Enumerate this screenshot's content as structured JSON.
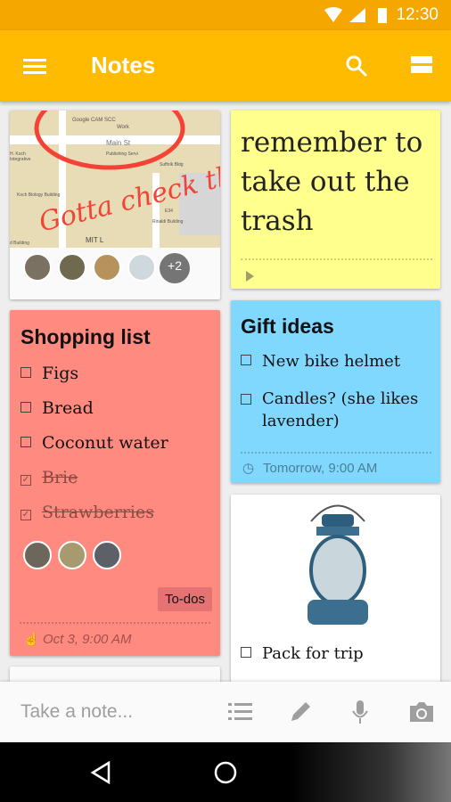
{
  "status": {
    "time": "12:30"
  },
  "appbar": {
    "title": "Notes",
    "icons": [
      "menu-icon",
      "search-icon",
      "view-toggle-icon"
    ]
  },
  "map_note": {
    "map_labels": [
      "Google CAM SCC",
      "Work",
      "Main St",
      "Publishing Servi",
      "H. Koch Integrative",
      "Suffolk Bldg",
      "Koch Biology Building",
      "E34",
      "Rinaldi Building",
      "d Building",
      "MIT L"
    ],
    "handwriting": "Gotta check the atrium!",
    "extra_collaborators": "+2"
  },
  "trash_note": {
    "text": "remember to take out the trash"
  },
  "shopping": {
    "title": "Shopping list",
    "items": [
      {
        "text": "Figs",
        "checked": false
      },
      {
        "text": "Bread",
        "checked": false
      },
      {
        "text": "Coconut water",
        "checked": false
      },
      {
        "text": "Brie",
        "checked": true
      },
      {
        "text": "Strawberries",
        "checked": true
      }
    ],
    "label": "To-dos",
    "reminder": "Oct 3, 9:00 AM",
    "color": "#ff8a80"
  },
  "gift": {
    "title": "Gift ideas",
    "items": [
      {
        "text": "New bike helmet"
      },
      {
        "text": "Candles? (she likes lavender)"
      }
    ],
    "reminder": "Tomorrow, 9:00 AM",
    "color": "#80d8ff"
  },
  "lantern": {
    "items": [
      {
        "text": "Pack for trip"
      }
    ]
  },
  "bottom": {
    "placeholder": "Take a note..."
  }
}
